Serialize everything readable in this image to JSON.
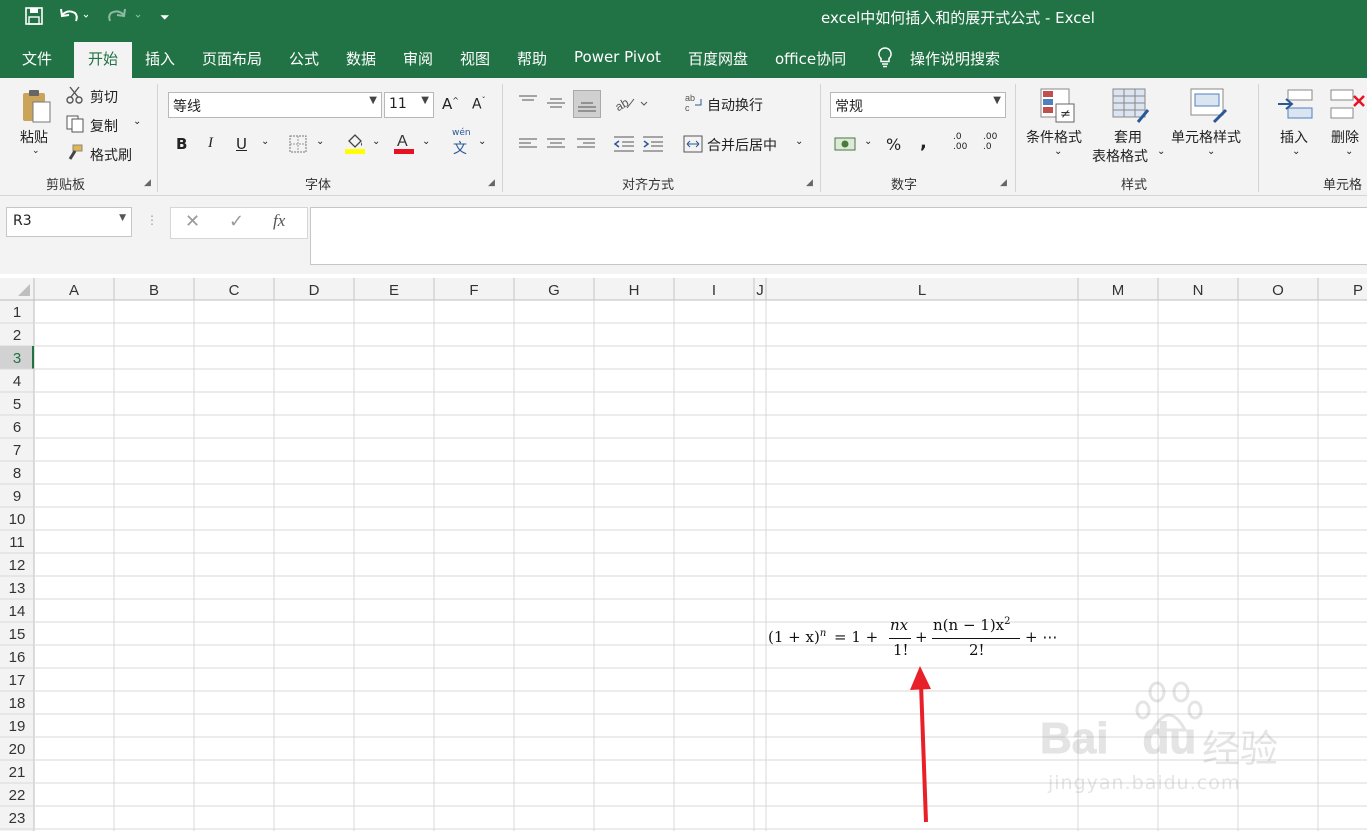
{
  "window": {
    "title": "excel中如何插入和的展开式公式  -  Excel"
  },
  "tabs": [
    "文件",
    "开始",
    "插入",
    "页面布局",
    "公式",
    "数据",
    "审阅",
    "视图",
    "帮助",
    "Power Pivot",
    "百度网盘",
    "office协同"
  ],
  "tell_me": "操作说明搜索",
  "clipboard": {
    "paste": "粘贴",
    "cut": "剪切",
    "copy": "复制",
    "format_painter": "格式刷",
    "label": "剪贴板"
  },
  "font": {
    "name": "等线",
    "size": "11",
    "bold": "B",
    "italic": "I",
    "underline": "U",
    "phonetic": "wén",
    "phonetic2": "文",
    "label": "字体"
  },
  "alignment": {
    "wrap_text": "自动换行",
    "merge_center": "合并后居中",
    "label": "对齐方式"
  },
  "number": {
    "format": "常规",
    "percent": "%",
    "comma": ",",
    "inc_decimal": ".0",
    "inc_decimal2": ".00",
    "dec_decimal": ".00",
    "dec_decimal2": ".0",
    "label": "数字"
  },
  "styles": {
    "conditional": "条件格式",
    "table_format": "套用",
    "table_format2": "表格格式",
    "cell_styles": "单元格样式",
    "label": "样式"
  },
  "cells": {
    "insert": "插入",
    "delete": "删除",
    "label": "单元格"
  },
  "formula_bar": {
    "name_box": "R3",
    "cancel": "✕",
    "enter": "✓",
    "fx": "fx",
    "value": ""
  },
  "grid": {
    "columns": [
      "A",
      "B",
      "C",
      "D",
      "E",
      "F",
      "G",
      "H",
      "I",
      "J",
      "L",
      "M",
      "N",
      "O",
      "P"
    ],
    "rows": [
      "1",
      "2",
      "3",
      "4",
      "5",
      "6",
      "7",
      "8",
      "9",
      "10",
      "11",
      "12",
      "13",
      "14",
      "15",
      "16",
      "17",
      "18",
      "19",
      "20",
      "21",
      "22",
      "23"
    ],
    "selected_row": "3"
  },
  "equation": {
    "lhs": "(1 + x)",
    "lhs_exp": "n",
    "eq": "= 1 +",
    "t1_num": "nx",
    "t1_den": "1!",
    "plus1": "+",
    "t2_num": "n(n − 1)x",
    "t2_num_exp": "2",
    "t2_den": "2!",
    "tail": "+ ⋯"
  },
  "watermark": {
    "brand": "Bai",
    "brand2": "du",
    "cn": "经验",
    "url": "jingyan.baidu.com"
  },
  "colors": {
    "excel_green": "#217346",
    "arrow_red": "#e8202a",
    "font_color_bar": "#e81123",
    "fill_color_bar": "#ffff00"
  }
}
